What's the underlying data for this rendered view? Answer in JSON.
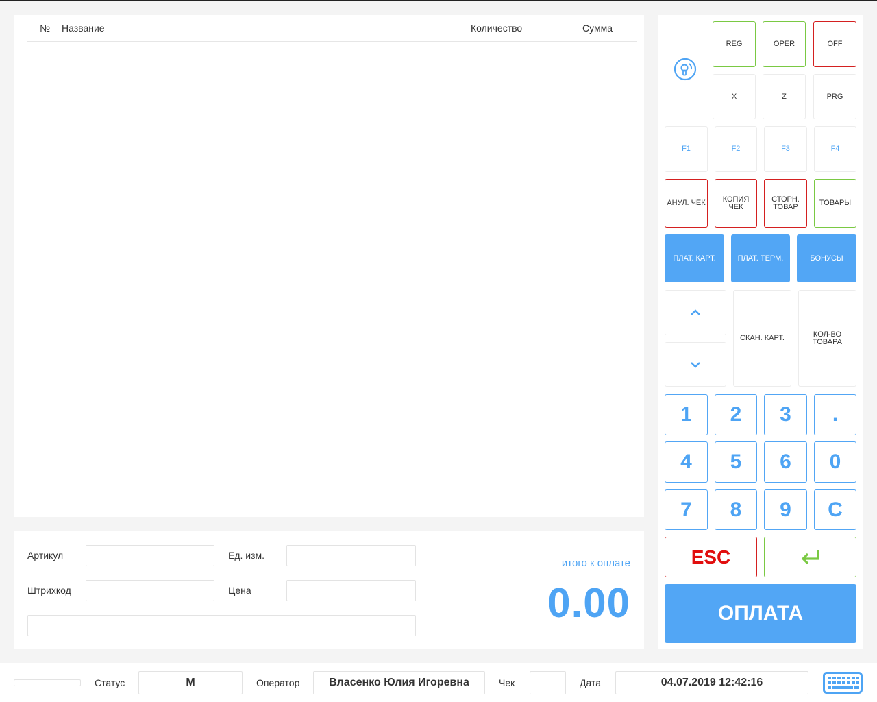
{
  "table": {
    "headers": {
      "num": "№",
      "name": "Название",
      "qty": "Количество",
      "sum": "Сумма"
    },
    "rows": []
  },
  "entry": {
    "article_label": "Артикул",
    "unit_label": "Ед. изм.",
    "barcode_label": "Штрихкод",
    "price_label": "Цена",
    "article_value": "",
    "unit_value": "",
    "barcode_value": "",
    "price_value": "",
    "name_value": "",
    "total_label": "итого к оплате",
    "total_value": "0.00"
  },
  "keypad": {
    "mode": {
      "reg": "REG",
      "oper": "OPER",
      "off": "OFF",
      "x": "X",
      "z": "Z",
      "prg": "PRG"
    },
    "fkeys": [
      "F1",
      "F2",
      "F3",
      "F4"
    ],
    "functions": {
      "cancel": "АНУЛ. ЧЕК",
      "copy": "КОПИЯ ЧЕК",
      "reverse_line1": "СТОРН.",
      "reverse_line2": "ТОВАР",
      "goods": "ТОВАРЫ"
    },
    "payment": {
      "card": "ПЛАТ. КАРТ.",
      "terminal": "ПЛАТ. ТЕРМ.",
      "bonus": "БОНУСЫ"
    },
    "scan_card": "СКАН. КАРТ.",
    "item_qty": "КОЛ-ВО ТОВАРА",
    "digits": [
      "1",
      "2",
      "3",
      ".",
      "4",
      "5",
      "6",
      "0",
      "7",
      "8",
      "9",
      "C"
    ],
    "esc": "ESC",
    "pay": "ОПЛАТА"
  },
  "statusbar": {
    "progress": 0,
    "status_label": "Статус",
    "status_value": "М",
    "operator_label": "Оператор",
    "operator_value": "Власенко Юлия Игоревна",
    "check_label": "Чек",
    "check_value": "",
    "date_label": "Дата",
    "date_value": "04.07.2019 12:42:16"
  },
  "colors": {
    "accent": "#52a6f5",
    "green": "#7ac943",
    "red": "#d42020"
  }
}
